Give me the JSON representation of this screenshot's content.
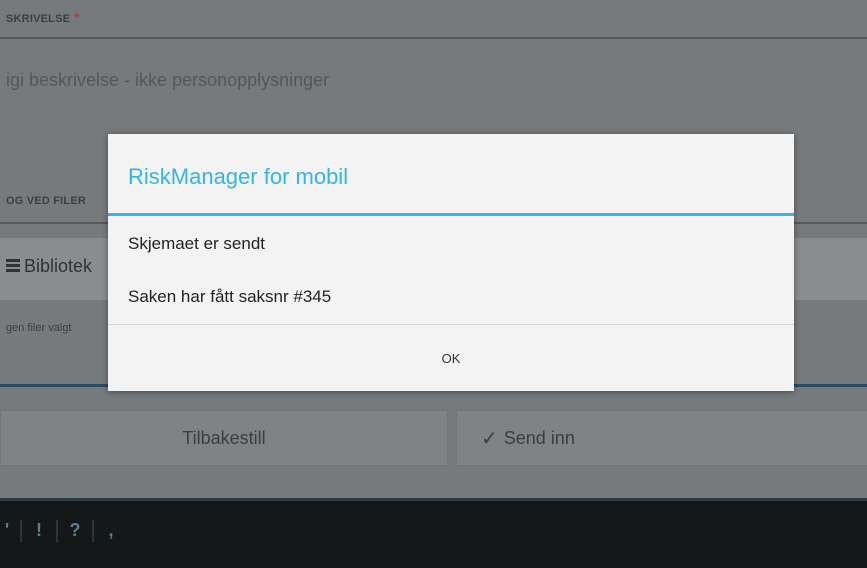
{
  "form": {
    "description_label": "SKRIVELSE",
    "required_mark": "*",
    "description_placeholder": "igi beskrivelse - ikke personopplysninger",
    "attach_label": "OG VED FILER",
    "library_label": "Bibliotek",
    "no_files_text": "gen filer valgt",
    "reset_button": "Tilbakestill",
    "send_button": "Send inn"
  },
  "keyboard": {
    "keys": [
      "'",
      "!",
      "?",
      ","
    ]
  },
  "dialog": {
    "title": "RiskManager for mobil",
    "message_line1": "Skjemaet er sendt",
    "message_line2": "Saken har fått saksnr #345",
    "ok_label": "OK"
  },
  "colors": {
    "accent": "#33b5e5",
    "dialog_bg": "#f3f3f3",
    "dim_overlay": "#777a7c"
  }
}
